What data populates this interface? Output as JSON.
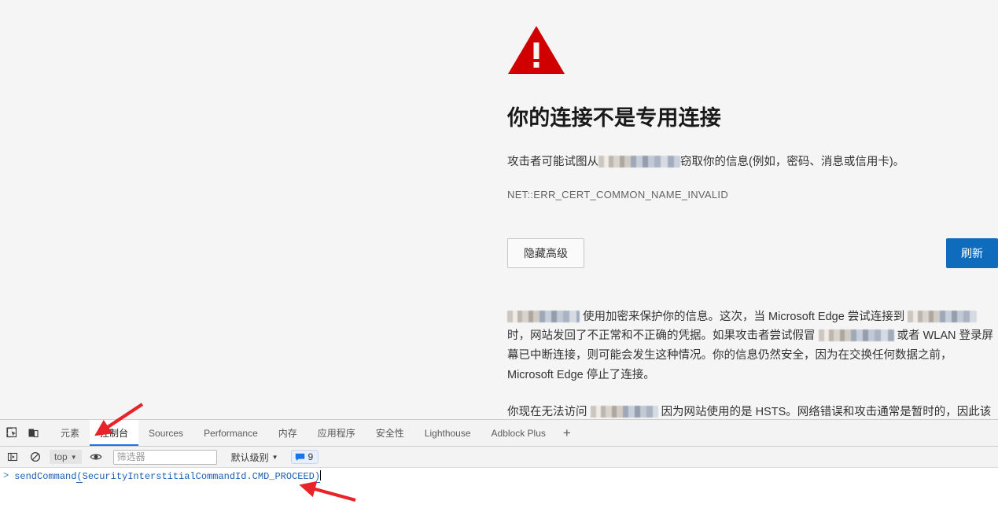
{
  "page": {
    "icon": "warning-triangle-icon",
    "accent_red": "#d10000",
    "title": "你的连接不是专用连接",
    "lead_before": "攻击者可能试图从",
    "lead_after": "窃取你的信息(例如，密码、消息或信用卡)。",
    "error_code": "NET::ERR_CERT_COMMON_NAME_INVALID",
    "buttons": {
      "hide_advanced": "隐藏高级",
      "refresh": "刷新",
      "primary_color": "#0f6cbd"
    },
    "advanced": {
      "p1_seg1": "使用加密来保护你的信息。这次，当 Microsoft Edge 尝试连接到",
      "p1_seg2": "时，网站发回了不正常和不正确的凭据。如果攻击者尝试假冒",
      "p1_seg3": "或者 WLAN 登录屏幕已中断连接，则可能会发生这种情况。你的信息仍然安全，因为在交换任何数据之前，Microsoft Edge 停止了连接。",
      "p2_seg1": "你现在无法访问",
      "p2_seg2": "因为网站使用的是 HSTS。网络错误和攻击通常是暂时的，因此该页面以后可能会恢复正常。"
    }
  },
  "devtools": {
    "inspect_icon": "inspect-element-icon",
    "device_icon": "device-toolbar-icon",
    "tabs": [
      {
        "label": "元素",
        "active": false
      },
      {
        "label": "控制台",
        "active": true
      },
      {
        "label": "Sources",
        "active": false
      },
      {
        "label": "Performance",
        "active": false
      },
      {
        "label": "内存",
        "active": false
      },
      {
        "label": "应用程序",
        "active": false
      },
      {
        "label": "安全性",
        "active": false
      },
      {
        "label": "Lighthouse",
        "active": false
      },
      {
        "label": "Adblock Plus",
        "active": false
      }
    ],
    "more_tabs_label": "+",
    "console": {
      "sidebar_toggle_icon": "console-sidebar-toggle-icon",
      "clear_icon": "clear-console-icon",
      "context": "top",
      "eye_icon": "live-expression-eye-icon",
      "filter_placeholder": "筛选器",
      "filter_value": "",
      "level": "默认级别",
      "message_count": "9",
      "message_icon": "message-bubble-icon",
      "prompt_symbol": ">",
      "command_pre": "sendCommand",
      "command_open_paren": "(",
      "command_mid": "SecurityInterstitialCommandId.CMD_PROCEED",
      "command_close_paren": ")"
    }
  },
  "annotations": {
    "arrow_color": "#e8232a",
    "arrow_console_tab": "arrow-pointing-to-console-tab",
    "arrow_command_line": "arrow-pointing-to-command-line"
  }
}
